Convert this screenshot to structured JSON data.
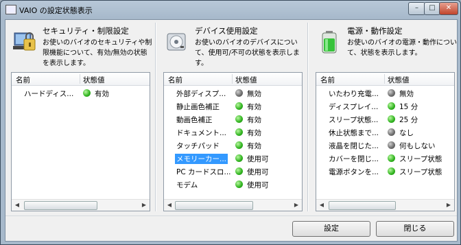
{
  "window": {
    "title": "VAIO の設定状態表示",
    "controls": {
      "minimize": "–",
      "maximize": "□",
      "close": "✕"
    }
  },
  "panels": [
    {
      "title": "セキュリティ・制限設定",
      "description": "お使いのバイオのセキュリティや制限機能について、有効/無効の状態を表示します。",
      "icon": "security-lock-icon",
      "columns": {
        "name": "名前",
        "value": "状態値"
      },
      "rows": [
        {
          "name": "ハードディス...",
          "status": "green",
          "value": "有効"
        }
      ]
    },
    {
      "title": "デバイス使用設定",
      "description": "お使いのバイオのデバイスについて、使用可/不可の状態を表示します。",
      "icon": "device-disk-icon",
      "columns": {
        "name": "名前",
        "value": "状態値"
      },
      "rows": [
        {
          "name": "外部ディスプ...",
          "status": "gray",
          "value": "無効"
        },
        {
          "name": "静止画色補正",
          "status": "green",
          "value": "有効"
        },
        {
          "name": "動画色補正",
          "status": "green",
          "value": "有効"
        },
        {
          "name": "ドキュメント...",
          "status": "green",
          "value": "有効"
        },
        {
          "name": "タッチパッド",
          "status": "green",
          "value": "有効"
        },
        {
          "name": "メモリーカー...",
          "status": "green",
          "value": "使用可",
          "selected": true
        },
        {
          "name": "PC カードスロ...",
          "status": "green",
          "value": "使用可"
        },
        {
          "name": "モデム",
          "status": "green",
          "value": "使用可"
        }
      ]
    },
    {
      "title": "電源・動作設定",
      "description": "お使いのバイオの電源・動作について、状態を表示します。",
      "icon": "battery-icon",
      "columns": {
        "name": "名前",
        "value": "状態値"
      },
      "rows": [
        {
          "name": "いたわり充電...",
          "status": "gray",
          "value": "無効"
        },
        {
          "name": "ディスプレイ...",
          "status": "green",
          "value": "15 分"
        },
        {
          "name": "スリープ状態...",
          "status": "green",
          "value": "25 分"
        },
        {
          "name": "休止状態まで...",
          "status": "gray",
          "value": "なし"
        },
        {
          "name": "液晶を閉じた...",
          "status": "gray",
          "value": "何もしない"
        },
        {
          "name": "カバーを閉じ...",
          "status": "green",
          "value": "スリープ状態"
        },
        {
          "name": "電源ボタンを...",
          "status": "green",
          "value": "スリープ状態"
        }
      ]
    }
  ],
  "buttons": {
    "settings": "設定",
    "close": "閉じる"
  },
  "colors": {
    "status_green": "#2fb31e",
    "status_gray": "#6b6b6b",
    "selection": "#3399ff"
  }
}
